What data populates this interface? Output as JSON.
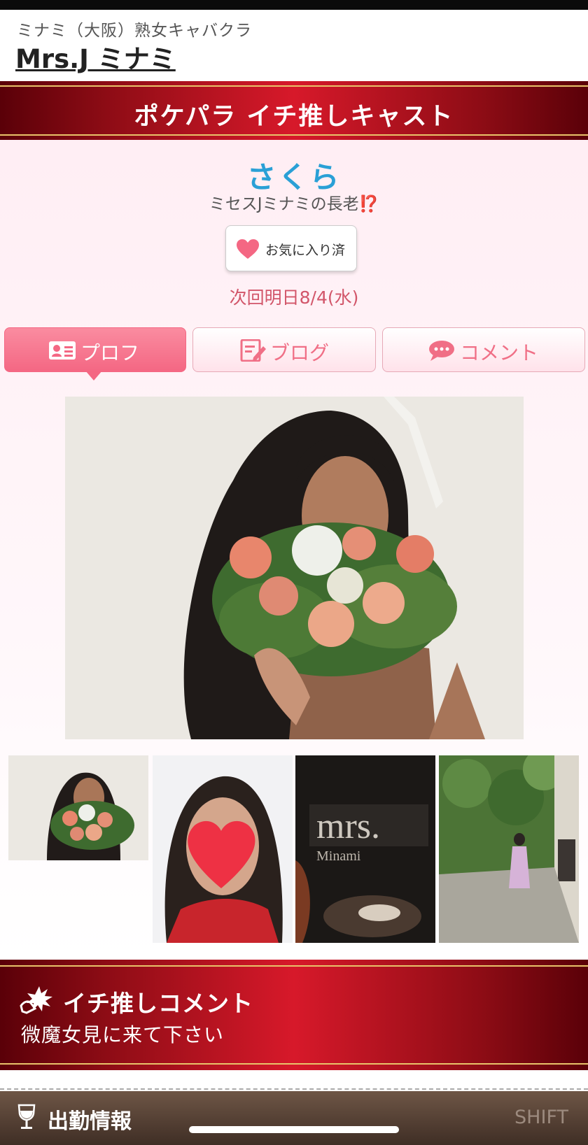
{
  "shop": {
    "area": "ミナミ（大阪）熟女キャバクラ",
    "name": "Mrs.J ミナミ"
  },
  "banner": {
    "title": "ポケパラ イチ推しキャスト"
  },
  "cast": {
    "name": "さくら",
    "catch_text": "ミセスJミナミの長老",
    "catch_emoji": "⁉️",
    "favorite_label": "お気に入り済",
    "next_shift": "次回明日8/4(水)"
  },
  "tabs": [
    {
      "label": "プロフ",
      "icon": "profile-card-icon",
      "active": true
    },
    {
      "label": "ブログ",
      "icon": "blog-edit-icon",
      "active": false
    },
    {
      "label": "コメント",
      "icon": "comment-bubble-icon",
      "active": false
    }
  ],
  "comment": {
    "title": "イチ推しコメント",
    "icon": "sparkle-hand-icon",
    "text": "微魔女見に来て下さい"
  },
  "footer": {
    "title": "出勤情報",
    "icon": "wine-glass-icon",
    "shift_label": "SHIFT"
  },
  "colors": {
    "accent_pink": "#f46783",
    "cast_name_blue": "#2aa0d6",
    "banner_red": "#d7192a",
    "next_shift_pink": "#d2566a"
  }
}
